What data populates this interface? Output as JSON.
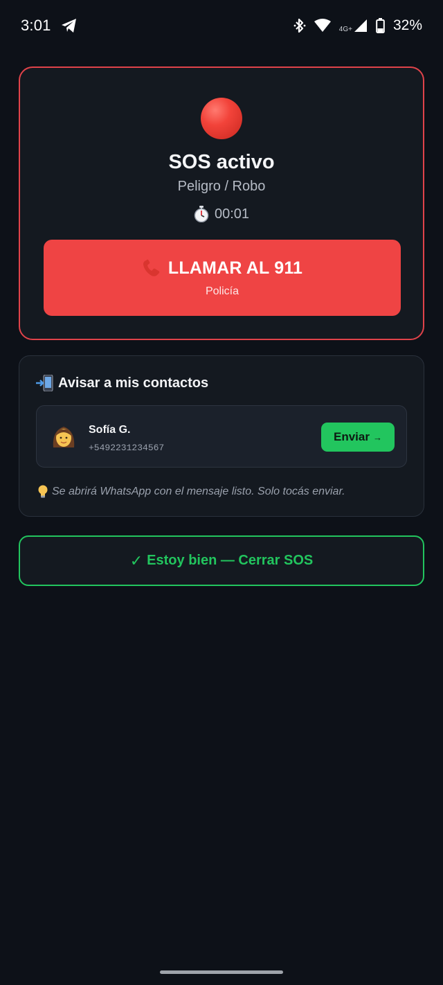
{
  "status_bar": {
    "time": "3:01",
    "network": "4G+",
    "battery": "32%",
    "icons": [
      "telegram-icon",
      "bluetooth-icon",
      "wifi-icon",
      "cell-signal-icon",
      "battery-icon"
    ]
  },
  "sos": {
    "title": "SOS activo",
    "subtitle": "Peligro / Robo",
    "timer": "00:01",
    "call_button": {
      "label": "LLAMAR AL 911",
      "sublabel": "Policía"
    }
  },
  "contacts": {
    "title": "Avisar a mis contactos",
    "items": [
      {
        "name": "Sofía G.",
        "phone": "+5492231234567",
        "avatar": "woman-emoji",
        "send_label": "Enviar",
        "send_arrow": "→"
      }
    ],
    "hint": "Se abrirá WhatsApp con el mensaje listo. Solo tocás enviar."
  },
  "close_sos": {
    "check": "✓",
    "label": "Estoy bien — Cerrar SOS"
  },
  "colors": {
    "background": "#0d1118",
    "card": "#141920",
    "danger": "#ef4444",
    "success": "#22c55e"
  }
}
